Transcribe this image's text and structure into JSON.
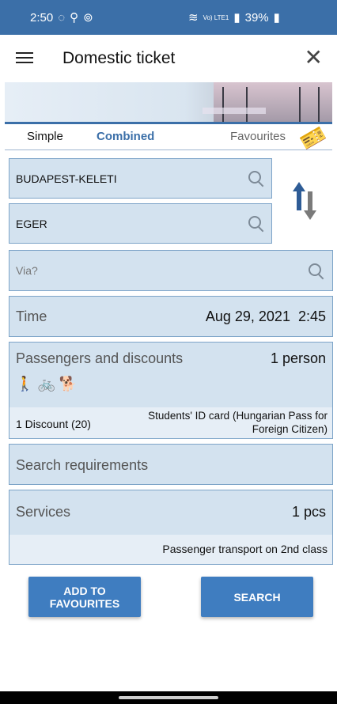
{
  "status_bar": {
    "time": "2:50",
    "battery": "39%",
    "signal": "Vo) LTE1"
  },
  "header": {
    "title": "Domestic ticket"
  },
  "tabs": [
    {
      "label": "Simple",
      "active": false
    },
    {
      "label": "Combined",
      "active": true
    },
    {
      "label": "Favourites",
      "active": false
    }
  ],
  "route": {
    "from": "BUDAPEST-KELETI",
    "to": "EGER",
    "via_placeholder": "Via?"
  },
  "time": {
    "label": "Time",
    "value": "Aug 29, 2021  2:45"
  },
  "passengers": {
    "label": "Passengers and discounts",
    "count": "1 person",
    "discount_label": "1 Discount (20)",
    "discount_desc": "Students' ID card (Hungarian Pass for Foreign Citizen)"
  },
  "search_requirements": {
    "label": "Search requirements"
  },
  "services": {
    "label": "Services",
    "count": "1 pcs",
    "desc": "Passenger transport on 2nd class"
  },
  "buttons": {
    "add_fav_line1": "ADD TO",
    "add_fav_line2": "FAVOURITES",
    "search": "SEARCH"
  },
  "colors": {
    "accent": "#3b6fa8",
    "field_bg": "#d3e2ef",
    "button": "#3f7dc0"
  }
}
